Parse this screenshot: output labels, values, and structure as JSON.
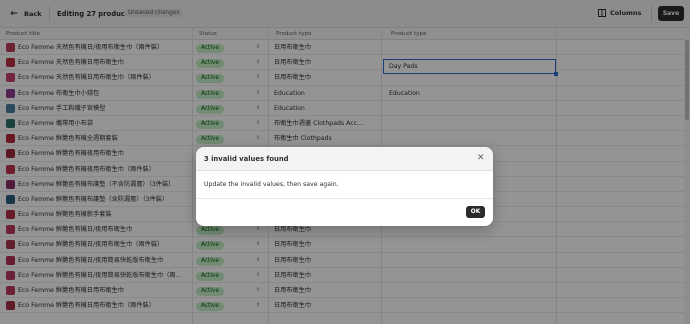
{
  "header": {
    "back_label": "Back",
    "title": "Editing 27 products",
    "unsaved_badge": "Unsaved changes",
    "columns_label": "Columns",
    "save_label": "Save"
  },
  "table": {
    "headers": [
      "Product title",
      "Status",
      "Product type",
      "Product type"
    ],
    "rows": [
      {
        "title": "Eco Femme 天然色有機日/夜用布衛生巾（兩件裝）",
        "status": "Active",
        "type": "日用布衛生巾",
        "type2": ""
      },
      {
        "title": "Eco Femme 天然色有機日用布衛生巾",
        "status": "Active",
        "type": "日用布衛生巾",
        "type2": "Day Pads"
      },
      {
        "title": "Eco Femme 天然色有機日用布衛生巾（兩件裝）",
        "status": "Active",
        "type": "日用布衛生巾",
        "type2": ""
      },
      {
        "title": "Eco Femme 布衛生巾小錢包",
        "status": "Active",
        "type": "Education",
        "type2": "Education"
      },
      {
        "title": "Eco Femme 手工鈎織子宮模型",
        "status": "Active",
        "type": "Education",
        "type2": ""
      },
      {
        "title": "Eco Femme 攜帶用小布袋",
        "status": "Active",
        "type": "布衛生巾週邊 Clothpads Acc...",
        "type2": ""
      },
      {
        "title": "Eco Femme 鮮艷色有機全週期套裝",
        "status": "Active",
        "type": "布衛生巾 Clothpads",
        "type2": ""
      },
      {
        "title": "Eco Femme 鮮艷色有機夜用布衛生巾",
        "status": "Active",
        "type": "",
        "type2": ""
      },
      {
        "title": "Eco Femme 鮮艷色有機夜用布衛生巾（兩件裝）",
        "status": "Active",
        "type": "",
        "type2": ""
      },
      {
        "title": "Eco Femme 鮮艷色有機布護墊（不含防漏層）（3件裝）",
        "status": "Active",
        "type": "",
        "type2": ""
      },
      {
        "title": "Eco Femme 鮮艷色有機布護墊（含防漏層）（3件裝）",
        "status": "Active",
        "type": "",
        "type2": ""
      },
      {
        "title": "Eco Femme 鮮艷色有機新手套裝",
        "status": "Active",
        "type": "",
        "type2": ""
      },
      {
        "title": "Eco Femme 鮮艷色有機日/夜用布衛生巾",
        "status": "Active",
        "type": "日用布衛生巾",
        "type2": ""
      },
      {
        "title": "Eco Femme 鮮艷色有機日/夜用布衛生巾（兩件裝）",
        "status": "Active",
        "type": "日用布衛生巾",
        "type2": ""
      },
      {
        "title": "Eco Femme 鮮艷色有機日/夜用簡易快乾版布衛生巾",
        "status": "Active",
        "type": "日用布衛生巾",
        "type2": ""
      },
      {
        "title": "Eco Femme 鮮艷色有機日/夜用簡易快乾版布衛生巾（兩...",
        "status": "Active",
        "type": "日用布衛生巾",
        "type2": ""
      },
      {
        "title": "Eco Femme 鮮艷色有機日用布衛生巾",
        "status": "Active",
        "type": "日用布衛生巾",
        "type2": ""
      },
      {
        "title": "Eco Femme 鮮艷色有機日用布衛生巾（兩件裝）",
        "status": "Active",
        "type": "日用布衛生巾",
        "type2": ""
      }
    ]
  },
  "modal": {
    "title": "3 invalid values found",
    "message": "Update the invalid values, then save again.",
    "ok_label": "OK"
  },
  "icons": {
    "back": "arrow-left-icon",
    "columns": "columns-icon",
    "close": "close-icon",
    "chevron": "chevron-updown-icon",
    "thumbnail": "product-thumbnail"
  },
  "colors": {
    "status_bg": "#c4f0c4",
    "status_text": "#0b5c1e",
    "focus_border": "#2c6ecb",
    "primary_button": "#2b2b2b"
  }
}
